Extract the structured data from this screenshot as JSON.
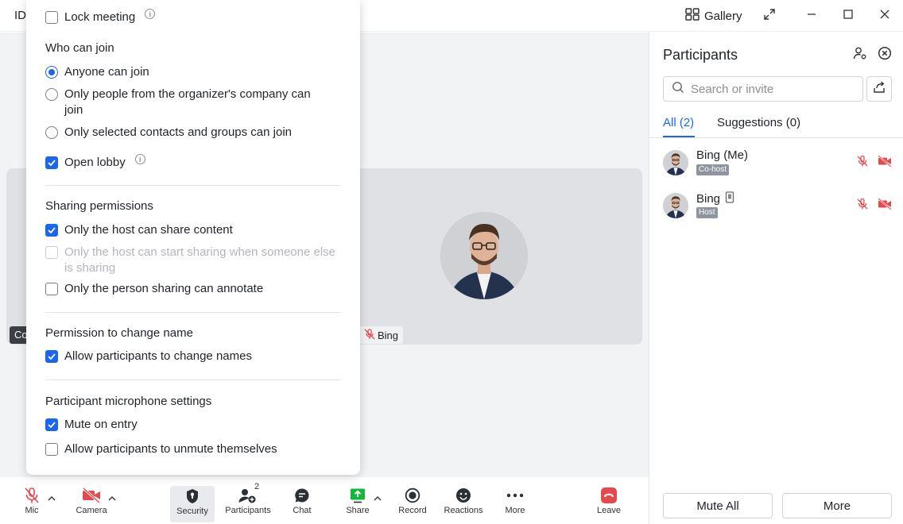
{
  "titlebar": {
    "id_label": "ID",
    "gallery_label": "Gallery",
    "icons": [
      "gallery-grid-icon",
      "fullscreen-icon",
      "minimize-icon",
      "maximize-icon",
      "close-icon"
    ]
  },
  "security_popup": {
    "lock_meeting": {
      "label": "Lock meeting",
      "checked": false
    },
    "who_can_join": {
      "title": "Who can join",
      "options": [
        {
          "label": "Anyone can join",
          "selected": true
        },
        {
          "label": "Only people from the organizer's company can join",
          "selected": false
        },
        {
          "label": "Only selected contacts and groups can join",
          "selected": false
        }
      ]
    },
    "open_lobby": {
      "label": "Open lobby",
      "checked": true
    },
    "sharing": {
      "title": "Sharing permissions",
      "host_only": {
        "label": "Only the host can share content",
        "checked": true
      },
      "host_start": {
        "label": "Only the host can start sharing when someone else is sharing",
        "checked": false,
        "disabled": true
      },
      "annotate": {
        "label": "Only the person sharing can annotate",
        "checked": false
      }
    },
    "rename": {
      "title": "Permission to change name",
      "allow": {
        "label": "Allow participants to change names",
        "checked": true
      }
    },
    "mic": {
      "title": "Participant microphone settings",
      "mute_entry": {
        "label": "Mute on entry",
        "checked": true
      },
      "unmute_self": {
        "label": "Allow participants to unmute themselves",
        "checked": false
      }
    }
  },
  "stage": {
    "tile_name": "Bing",
    "tile_badge": "Co-"
  },
  "participants": {
    "title": "Participants",
    "search_placeholder": "Search or invite",
    "tabs": [
      {
        "label": "All (2)",
        "active": true
      },
      {
        "label": "Suggestions (0)",
        "active": false
      }
    ],
    "list": [
      {
        "name": "Bing (Me)",
        "role": "Co-host",
        "mobile": false
      },
      {
        "name": "Bing",
        "role": "Host",
        "mobile": true
      }
    ],
    "mute_all": "Mute All",
    "more": "More"
  },
  "toolbar": {
    "mic": "Mic",
    "camera": "Camera",
    "security": "Security",
    "participants": "Participants",
    "participants_count": "2",
    "chat": "Chat",
    "share": "Share",
    "record": "Record",
    "reactions": "Reactions",
    "more": "More",
    "leave": "Leave"
  },
  "colors": {
    "accent": "#1a66f2",
    "danger": "#e5484d",
    "share_green": "#12b83a"
  }
}
